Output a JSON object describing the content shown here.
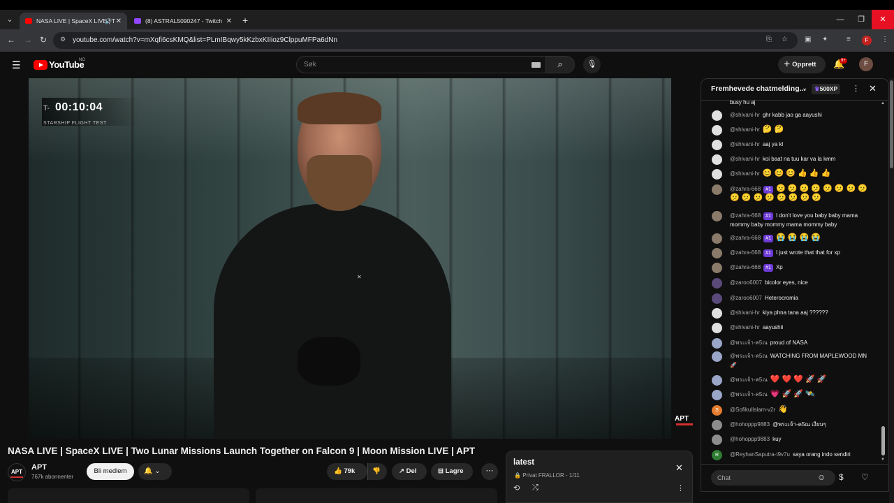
{
  "browser": {
    "tabs": [
      {
        "label": "NASA LIVE | SpaceX LIVE | T",
        "fav_color": "#ff0000",
        "active": true
      },
      {
        "label": "(8) ASTRAL5090247 - Twitch",
        "fav_color": "#9146ff",
        "active": false
      }
    ],
    "url": "youtube.com/watch?v=mXqfi6csKMQ&list=PLmIBqwy5kKzbxKIIioz9ClppuMFPa6dNn",
    "profile_initial": "F"
  },
  "header": {
    "logo_text": "YouTube",
    "country": "NO",
    "search_placeholder": "Søk",
    "create_label": "Opprett",
    "notif_badge": "9+",
    "avatar_initial": "F"
  },
  "video": {
    "tminus": "T-",
    "clock": "00:10:04",
    "subtitle": "STARSHIP FLIGHT TEST",
    "watermark": "APT",
    "title": "NASA LIVE | SpaceX LIVE | Two Lunar Missions Launch Together on Falcon 9 | Moon Mission LIVE | APT"
  },
  "channel": {
    "avatar_text": "APT",
    "name": "APT",
    "subs": "767k abonnenter",
    "member_label": "Bli medlem"
  },
  "actions": {
    "likes": "79k",
    "share": "Del",
    "save": "Lagre"
  },
  "playlist": {
    "title": "latest",
    "sub": "Privat FRALLOR - 1/11"
  },
  "chat": {
    "header_title": "Fremhevede chatmelding...",
    "xp": "500XP",
    "partial": "busy hu aj",
    "input_placeholder": "Chat",
    "messages": [
      {
        "author": "@shivani-hr",
        "text": "ghr kabb jao ga aayushi",
        "rank": "",
        "av": "#e0e0e0"
      },
      {
        "author": "@shivani-hr",
        "text": "🤔 🤔",
        "rank": "",
        "av": "#e0e0e0"
      },
      {
        "author": "@shivani-hr",
        "text": "aaj ya kl",
        "rank": "",
        "av": "#e0e0e0"
      },
      {
        "author": "@shivani-hr",
        "text": "koi baat na tuu kar va la kmm",
        "rank": "",
        "av": "#e0e0e0"
      },
      {
        "author": "@shivani-hr",
        "text": "😊 😊 😊 👍 👍 👍",
        "rank": "",
        "av": "#e0e0e0"
      },
      {
        "author": "@zahra-668",
        "text": "🫤 🫤 🫤 🫤 🫤 🫤 🫤 🫤 🫤 🫤 🫤 🫤 🫤 🫤 🫤 🫤",
        "rank": "#1",
        "av": "#8a7a6a"
      },
      {
        "author": "@zahra-668",
        "text": "I don't love you baby baby mama mommy baby mommy mama mommy baby",
        "rank": "#1",
        "av": "#8a7a6a"
      },
      {
        "author": "@zahra-668",
        "text": "😭 😭 😭 😭",
        "rank": "#1",
        "av": "#8a7a6a"
      },
      {
        "author": "@zahra-668",
        "text": "I just wrote that that for xp",
        "rank": "#1",
        "av": "#8a7a6a"
      },
      {
        "author": "@zahra-668",
        "text": "Xp",
        "rank": "#1",
        "av": "#8a7a6a"
      },
      {
        "author": "@zaroo6007",
        "text": "bicolor eyes, nice",
        "rank": "",
        "av": "#5a4a7a"
      },
      {
        "author": "@zaroo6007",
        "text": "Heterocromia",
        "rank": "",
        "av": "#5a4a7a"
      },
      {
        "author": "@shivani-hr",
        "text": "kiya phna tana aaj ??????",
        "rank": "",
        "av": "#e0e0e0"
      },
      {
        "author": "@shivani-hr",
        "text": "aayushii",
        "rank": "",
        "av": "#e0e0e0"
      },
      {
        "author": "@พระเจ้า-ค5ณ",
        "text": "proud of NASA",
        "rank": "",
        "av": "#9aa6c8"
      },
      {
        "author": "@พระเจ้า-ค5ณ",
        "text": "WATCHING FROM MAPLEWOOD MN 🚀",
        "rank": "",
        "av": "#9aa6c8"
      },
      {
        "author": "@พระเจ้า-ค5ณ",
        "text": "❤️ ❤️ ❤️ 🚀 🚀",
        "rank": "",
        "av": "#9aa6c8"
      },
      {
        "author": "@พระเจ้า-ค5ณ",
        "text": "💗 🚀 🚀 🛰️",
        "rank": "",
        "av": "#9aa6c8"
      },
      {
        "author": "@SofikulIslam-v2r",
        "text": "👋",
        "rank": "",
        "av": "#e67c2e"
      },
      {
        "author": "@hohoppp9883",
        "text": "@พระเจ้า-ค5ณ เงียบๆ",
        "rank": "",
        "av": "#8d8d8d"
      },
      {
        "author": "@hohoppp9883",
        "text": "kuy",
        "rank": "",
        "av": "#8d8d8d"
      },
      {
        "author": "@ReyhanSaputra-t9v7u",
        "text": "saya orang indo sendiri",
        "rank": "",
        "av": "#2e7d32"
      }
    ],
    "avatar_letters": {
      "SofikulIslam-v2r": "S",
      "ReyhanSaputra-t9v7u": "R"
    }
  },
  "colors": {
    "accent": "#ff0000",
    "rank": "#6d3bd6",
    "close": "#e81123"
  }
}
